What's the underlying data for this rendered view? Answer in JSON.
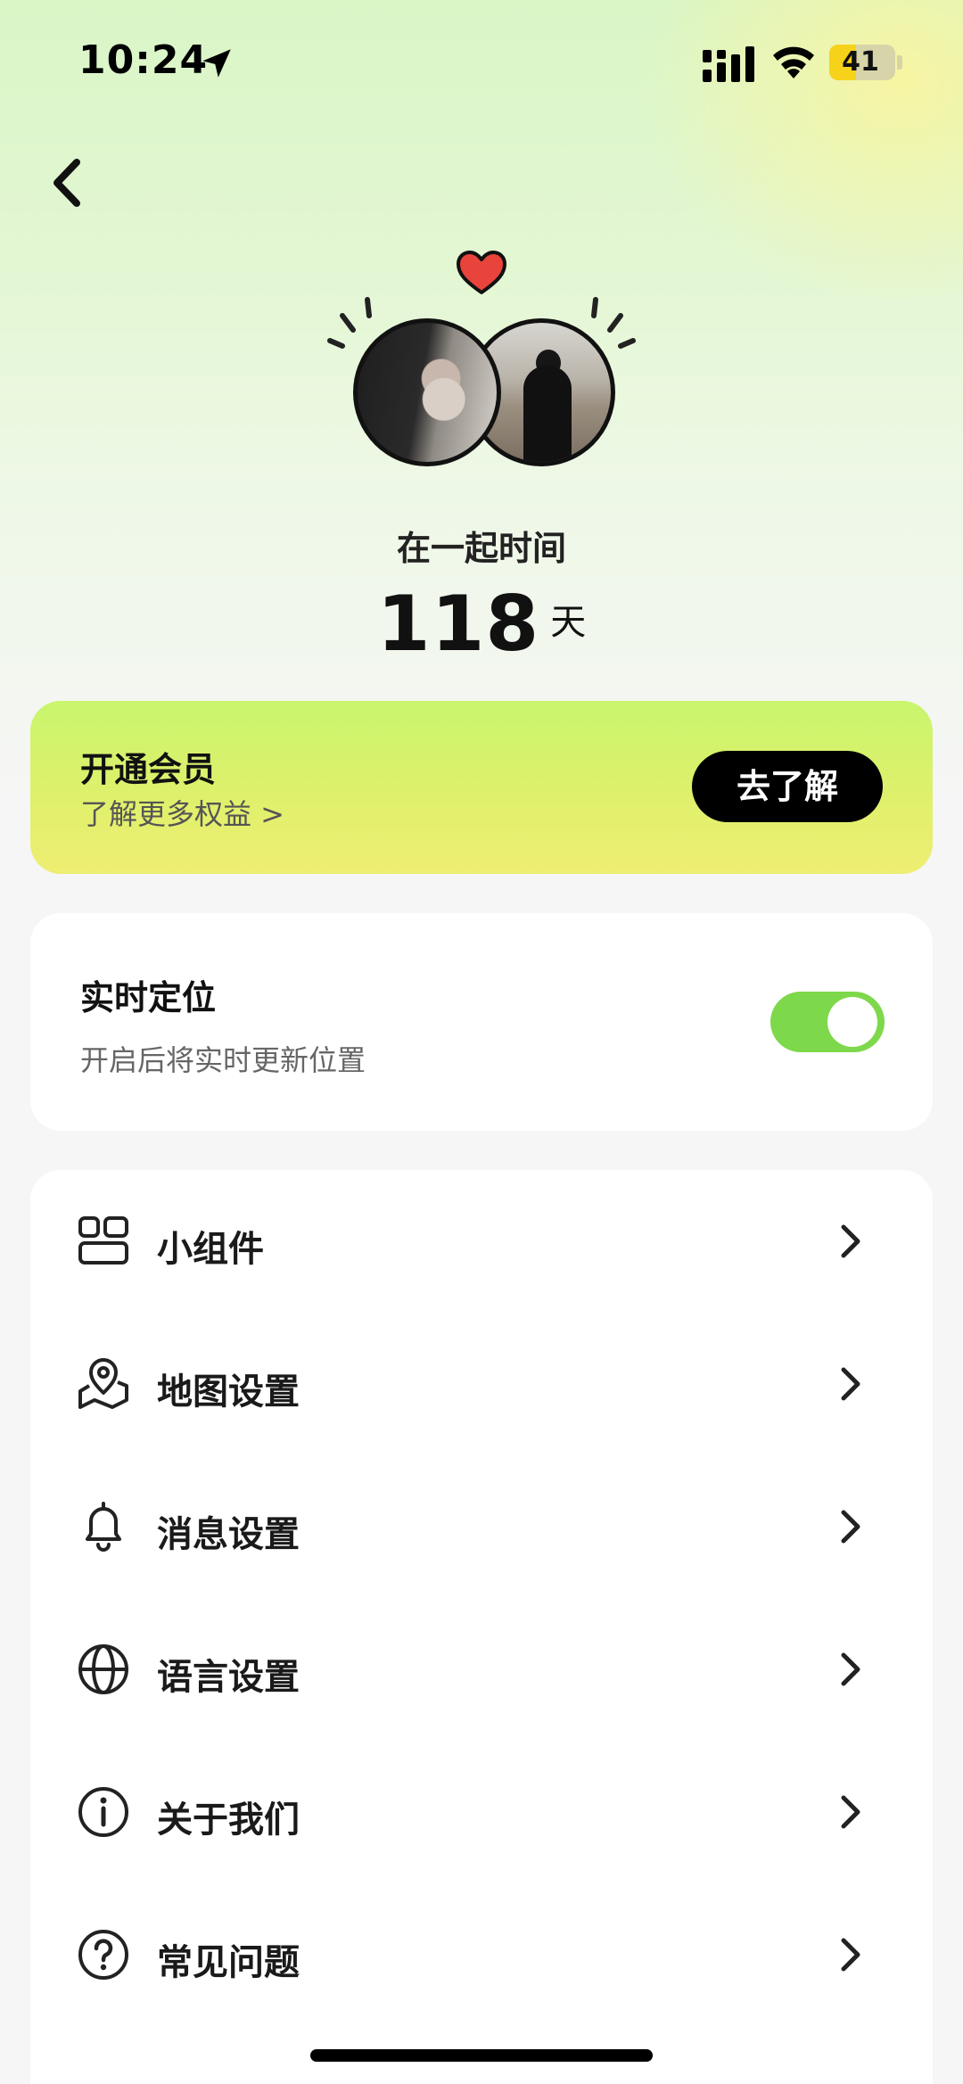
{
  "status_bar": {
    "time": "10:24",
    "battery": "41",
    "battery_level": 0.41
  },
  "couple": {
    "together_label": "在一起时间",
    "days_count": "118",
    "days_unit": "天"
  },
  "vip": {
    "title": "开通会员",
    "subtitle": "了解更多权益 >",
    "button_label": "去了解"
  },
  "realtime_location": {
    "title": "实时定位",
    "subtitle": "开启后将实时更新位置",
    "enabled": true
  },
  "menu": {
    "items": [
      {
        "label": "小组件",
        "icon": "widget-icon"
      },
      {
        "label": "地图设置",
        "icon": "map-icon"
      },
      {
        "label": "消息设置",
        "icon": "bell-icon"
      },
      {
        "label": "语言设置",
        "icon": "globe-icon"
      },
      {
        "label": "关于我们",
        "icon": "info-icon"
      },
      {
        "label": "常见问题",
        "icon": "question-icon"
      }
    ]
  },
  "colors": {
    "accent_green": "#7ed84b",
    "vip_gradient_top": "#c9f56d",
    "vip_gradient_bottom": "#eeee72",
    "heart_red": "#e8443b"
  }
}
